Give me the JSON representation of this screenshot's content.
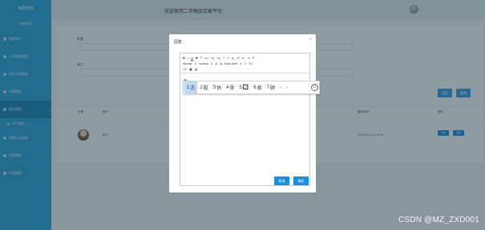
{
  "app": {
    "logo": "admin",
    "welcome": "欢迎使用二手物品交易平台"
  },
  "sidebar": {
    "home": "系统首页",
    "items": [
      {
        "label": "系统用户"
      },
      {
        "label": "二手物品管理"
      },
      {
        "label": "购买订单管理"
      },
      {
        "label": "求购管理"
      },
      {
        "label": "留言管理",
        "active": true,
        "sub": "用户留言"
      },
      {
        "label": "捐赠公示管理"
      },
      {
        "label": "资源管理"
      },
      {
        "label": "系统管理"
      }
    ]
  },
  "search": {
    "field1_label": "标题",
    "field2_label": "留言",
    "search_button": "搜索",
    "reset_button": "重置"
  },
  "table": {
    "headers": {
      "avatar": "头像",
      "user": "用户",
      "time": "最新时间",
      "ops": "操作"
    },
    "rows": [
      {
        "user": "用户",
        "time": "2024-03-15 11:28:46",
        "view_btn": "详情",
        "edit_btn": "回复"
      }
    ]
  },
  "dialog": {
    "title": "回复",
    "close": "×",
    "toolbar_row1": [
      "B",
      "I",
      "U",
      "S",
      "❝",
      "</>",
      "H₁",
      "H₂",
      "≡",
      "≡",
      "x₂",
      "x²",
      "⇤",
      "⇥",
      "↱"
    ],
    "toolbar_row2": [
      "Normal",
      "Normal",
      "A",
      "A̶",
      "Sans Serif",
      "≡",
      "Tx"
    ],
    "toolbar_row3": [
      "🔗",
      "▣",
      "▤"
    ],
    "typed_text": "gu",
    "cancel_button": "取消",
    "confirm_button": "确定"
  },
  "ime": {
    "candidates": [
      {
        "num": "1",
        "char": "古"
      },
      {
        "num": "2",
        "char": "股"
      },
      {
        "num": "3",
        "char": "估"
      },
      {
        "num": "4",
        "char": "骨"
      },
      {
        "num": "5",
        "char": "🔲"
      },
      {
        "num": "6",
        "char": "故"
      },
      {
        "num": "7",
        "char": "顾"
      }
    ],
    "prev": "‹",
    "next": "›",
    "emoji": "☺"
  },
  "watermark": "CSDN @MZ_ZXD001",
  "colors": {
    "sidebar": "#2ea5d8",
    "primary_button": "#1a8fe0",
    "candidate_highlight": "#b9d9f5"
  }
}
